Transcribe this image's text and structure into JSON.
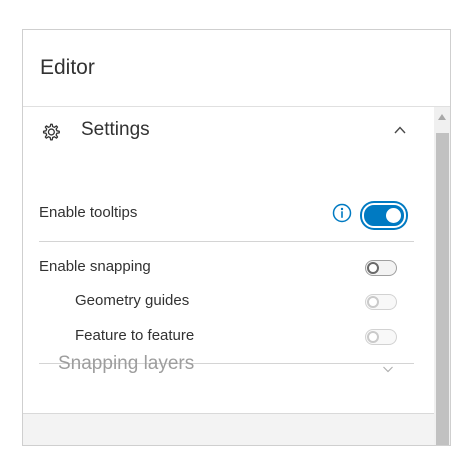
{
  "panel": {
    "title": "Editor"
  },
  "settings": {
    "label": "Settings",
    "icon": "gear-icon",
    "expanded": true,
    "collapse_icon": "chevron-up-icon"
  },
  "rows": {
    "tooltips": {
      "label": "Enable tooltips",
      "enabled": true,
      "info_icon": "info-icon"
    },
    "snapping": {
      "label": "Enable snapping",
      "enabled": false
    },
    "geometry_guides": {
      "label": "Geometry guides",
      "enabled": false,
      "disabled": true
    },
    "feature_to_feature": {
      "label": "Feature to feature",
      "enabled": false,
      "disabled": true
    }
  },
  "snapping_layers": {
    "label": "Snapping layers",
    "expand_icon": "chevron-down-icon",
    "disabled": true
  },
  "colors": {
    "accent": "#007ac2",
    "text": "#323232",
    "disabled_text": "#9d9d9d"
  }
}
